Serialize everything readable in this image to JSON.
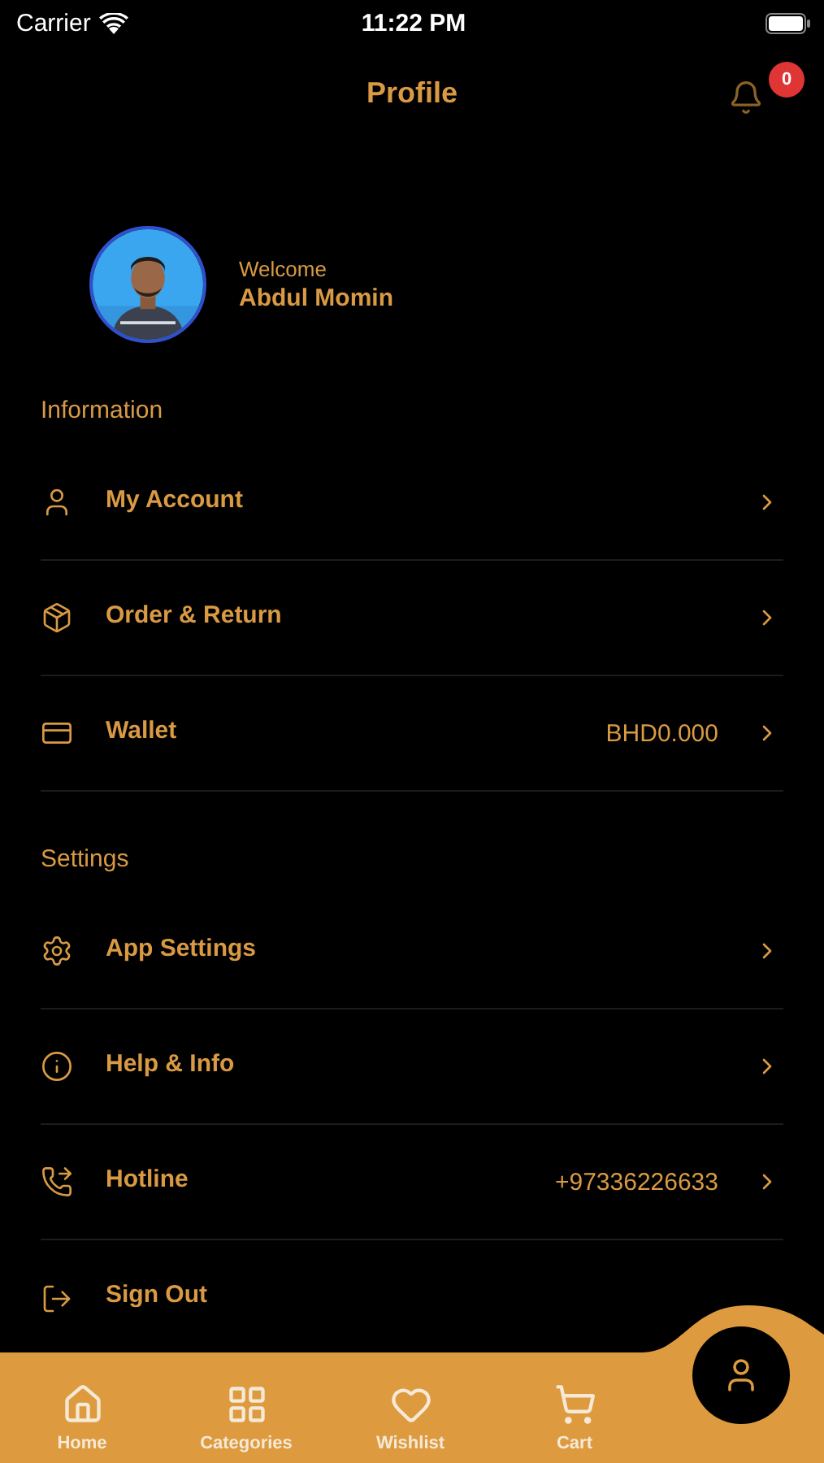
{
  "status_bar": {
    "carrier": "Carrier",
    "time": "11:22 PM"
  },
  "header": {
    "title": "Profile",
    "notification_count": "0"
  },
  "profile": {
    "greeting": "Welcome",
    "name": "Abdul Momin"
  },
  "sections": [
    {
      "title": "Information",
      "items": [
        {
          "label": "My Account",
          "kind": "link"
        },
        {
          "label": "Order & Return",
          "kind": "link"
        },
        {
          "label": "Wallet",
          "value": "BHD0.000",
          "kind": "link"
        }
      ]
    },
    {
      "title": "Settings",
      "items": [
        {
          "label": "App Settings",
          "kind": "link"
        },
        {
          "label": "Help & Info",
          "kind": "link"
        },
        {
          "label": "Hotline",
          "value": "+97336226633",
          "kind": "link"
        },
        {
          "label": "Sign Out",
          "kind": "action"
        }
      ]
    }
  ],
  "tab_bar": [
    {
      "label": "Home",
      "selected": false
    },
    {
      "label": "Categories",
      "selected": false
    },
    {
      "label": "Wishlist",
      "selected": false
    },
    {
      "label": "Cart",
      "selected": false
    },
    {
      "selected": true
    }
  ]
}
